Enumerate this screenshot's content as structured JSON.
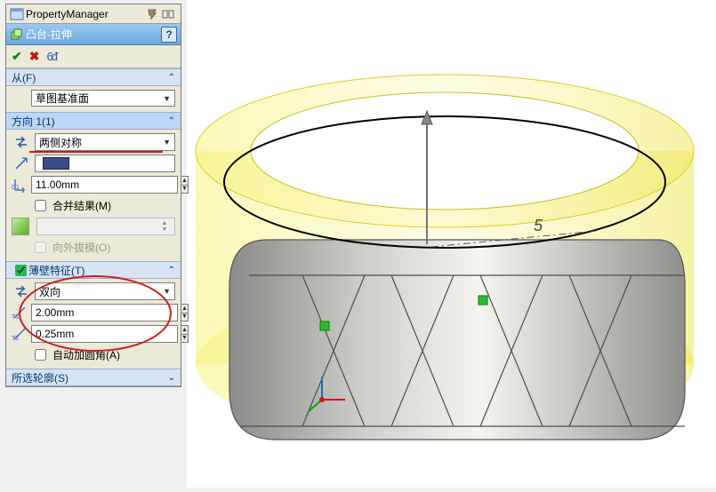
{
  "header": {
    "title": "PropertyManager"
  },
  "feature": {
    "title": "凸台-拉伸"
  },
  "sections": {
    "from": {
      "title": "从(F)",
      "plane_select": "草图基准面"
    },
    "dir1": {
      "title": "方向 1(1)",
      "mode_select": "两侧对称",
      "depth": "11.00mm",
      "merge_result": "合并结果(M)",
      "draft_outward": "向外拔模(O)"
    },
    "thin": {
      "title": "薄壁特征(T)",
      "mode_select": "双向",
      "t1": "2.00mm",
      "t2": "0.25mm",
      "auto_fillet": "自动加圆角(A)"
    },
    "contour": {
      "title": "所选轮廓(S)"
    }
  },
  "viewport": {
    "dim_label": "5"
  }
}
